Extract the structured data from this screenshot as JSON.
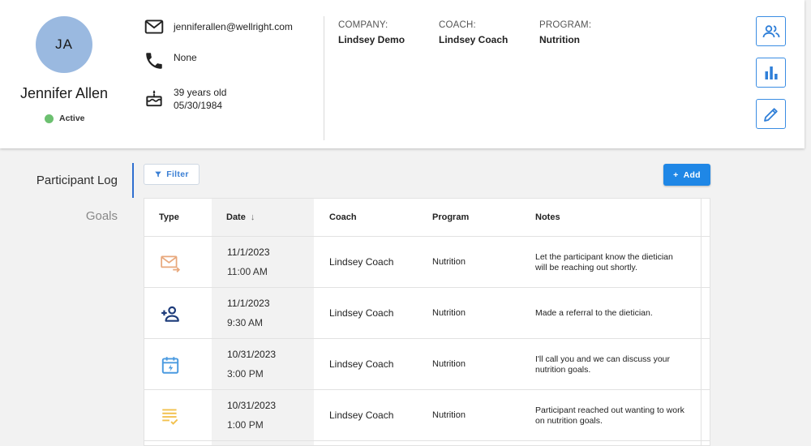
{
  "profile": {
    "initials": "JA",
    "name": "Jennifer Allen",
    "status": "Active",
    "email": "jenniferallen@wellright.com",
    "phone": "None",
    "age": "39 years old",
    "dob": "05/30/1984",
    "avatar_color": "#9ab9e0",
    "status_color": "#6cc070"
  },
  "info": {
    "company_label": "COMPANY:",
    "company_value": "Lindsey Demo",
    "coach_label": "COACH:",
    "coach_value": "Lindsey Coach",
    "program_label": "PROGRAM:",
    "program_value": "Nutrition"
  },
  "side_buttons": [
    {
      "icon": "people-icon"
    },
    {
      "icon": "bar-chart-icon"
    },
    {
      "icon": "pencil-icon"
    }
  ],
  "nav": {
    "items": [
      {
        "label": "Participant Log",
        "active": true
      },
      {
        "label": "Goals",
        "active": false
      }
    ]
  },
  "toolbar": {
    "filter_label": "Filter",
    "add_label": "Add"
  },
  "table": {
    "headers": {
      "type": "Type",
      "date": "Date",
      "date_sort": "↓",
      "coach": "Coach",
      "program": "Program",
      "notes": "Notes"
    },
    "rows": [
      {
        "type_icon": "email-forward-icon",
        "date": "11/1/2023",
        "time": "11:00 AM",
        "coach": "Lindsey Coach",
        "program": "Nutrition",
        "notes_line1": "Let the participant know the dietician",
        "notes_line2": "will be reaching out shortly."
      },
      {
        "type_icon": "add-person-icon",
        "date": "11/1/2023",
        "time": "9:30 AM",
        "coach": "Lindsey Coach",
        "program": "Nutrition",
        "notes_line1": "Made a referral to the dietician.",
        "notes_line2": ""
      },
      {
        "type_icon": "calendar-event-icon",
        "date": "10/31/2023",
        "time": "3:00 PM",
        "coach": "Lindsey Coach",
        "program": "Nutrition",
        "notes_line1": "I'll call you and we can discuss your",
        "notes_line2": "nutrition goals."
      },
      {
        "type_icon": "checklist-icon",
        "date": "10/31/2023",
        "time": "1:00 PM",
        "coach": "Lindsey Coach",
        "program": "Nutrition",
        "notes_line1": "Participant reached out wanting to work",
        "notes_line2": "on nutrition goals."
      }
    ]
  },
  "colors": {
    "accent": "#1f87e6",
    "nav_indicator": "#2f6fd0",
    "icon_email": "#e8a87c",
    "icon_person": "#1d3b7a",
    "icon_calendar": "#4a9ae0",
    "icon_checklist": "#f2c14e"
  }
}
